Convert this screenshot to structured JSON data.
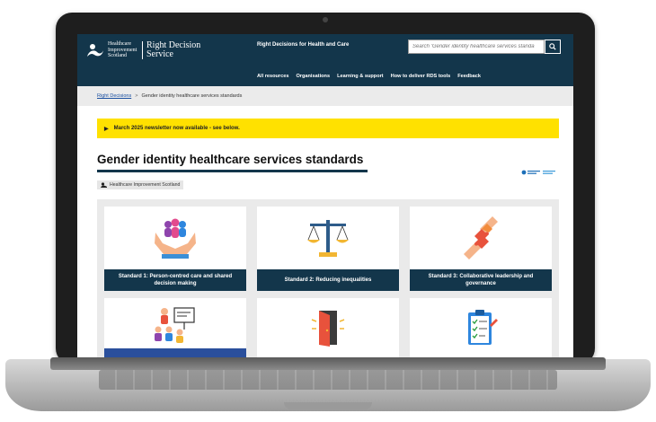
{
  "header": {
    "org_name": "Healthcare Improvement Scotland",
    "service_name": "Right Decision Service",
    "tagline": "Right Decisions for Health and Care",
    "search_placeholder": "Search 'Gender identity healthcare services standa",
    "nav": [
      "All resources",
      "Organisations",
      "Learning & support",
      "How to deliver RDS tools",
      "Feedback"
    ]
  },
  "breadcrumb": {
    "home": "Right Decisions",
    "separator": ">",
    "current": "Gender identity healthcare services standards"
  },
  "banner": {
    "text": "March 2025 newsletter now available - see below."
  },
  "page": {
    "title": "Gender identity healthcare services standards",
    "owner": "Healthcare Improvement Scotland"
  },
  "cards": [
    {
      "caption": "Standard 1: Person-centred care and shared decision making",
      "icon": "hands-people-icon"
    },
    {
      "caption": "Standard 2: Reducing inequalities",
      "icon": "scales-icon"
    },
    {
      "caption": "Standard 3: Collaborative leadership and governance",
      "icon": "puzzle-handshake-icon"
    },
    {
      "caption": "",
      "icon": "presentation-icon"
    },
    {
      "caption": "",
      "icon": "open-door-icon"
    },
    {
      "caption": "",
      "icon": "clipboard-checklist-icon"
    }
  ],
  "colors": {
    "header_bg": "#13364b",
    "banner_bg": "#ffe100",
    "breadcrumb_bg": "#ebebeb",
    "link": "#1a4fa0"
  }
}
